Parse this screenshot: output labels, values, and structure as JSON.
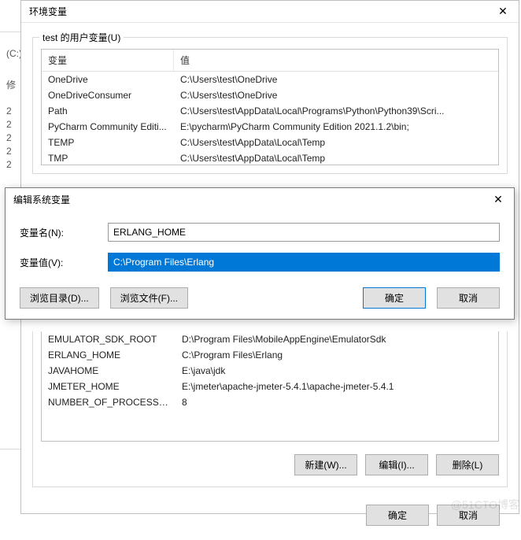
{
  "leftStrip": {
    "a": "(C:)",
    "b": "修",
    "n2": "2",
    "n3": "2",
    "n4": "2",
    "n5": "2",
    "n6": "2"
  },
  "envDialog": {
    "title": "环境变量",
    "userGroupLabel": "test 的用户变量(U)",
    "tableHeaders": {
      "name": "变量",
      "value": "值"
    },
    "userVars": [
      {
        "name": "OneDrive",
        "value": "C:\\Users\\test\\OneDrive"
      },
      {
        "name": "OneDriveConsumer",
        "value": "C:\\Users\\test\\OneDrive"
      },
      {
        "name": "Path",
        "value": "C:\\Users\\test\\AppData\\Local\\Programs\\Python\\Python39\\Scri..."
      },
      {
        "name": "PyCharm Community Editi...",
        "value": "E:\\pycharm\\PyCharm Community Edition 2021.1.2\\bin;"
      },
      {
        "name": "TEMP",
        "value": "C:\\Users\\test\\AppData\\Local\\Temp"
      },
      {
        "name": "TMP",
        "value": "C:\\Users\\test\\AppData\\Local\\Temp"
      }
    ],
    "systemVars": [
      {
        "name": "EMULATOR_SDK_ROOT",
        "value": "D:\\Program Files\\MobileAppEngine\\EmulatorSdk"
      },
      {
        "name": "ERLANG_HOME",
        "value": "C:\\Program Files\\Erlang"
      },
      {
        "name": "JAVAHOME",
        "value": "E:\\java\\jdk"
      },
      {
        "name": "JMETER_HOME",
        "value": "E:\\jmeter\\apache-jmeter-5.4.1\\apache-jmeter-5.4.1"
      },
      {
        "name": "NUMBER_OF_PROCESSORS",
        "value": "8"
      }
    ],
    "buttons": {
      "new": "新建(W)...",
      "edit": "编辑(I)...",
      "delete": "删除(L)",
      "ok": "确定",
      "cancel": "取消"
    }
  },
  "editDialog": {
    "title": "编辑系统变量",
    "nameLabel": "变量名(N):",
    "nameValue": "ERLANG_HOME",
    "valueLabel": "变量值(V):",
    "valueValue": "C:\\Program Files\\Erlang",
    "browseDir": "浏览目录(D)...",
    "browseFile": "浏览文件(F)...",
    "ok": "确定",
    "cancel": "取消"
  },
  "watermark": "@51CTO博客"
}
